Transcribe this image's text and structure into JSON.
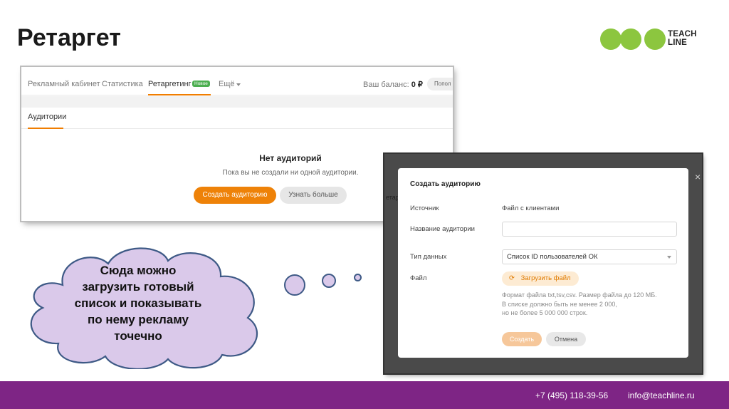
{
  "slide": {
    "title": "Ретаргет"
  },
  "logo": {
    "line1": "TEACH",
    "line2": "LINE",
    "color": "#8cc63f"
  },
  "screenshot1": {
    "nav": {
      "ad_cabinet": "Рекламный кабинет",
      "statistics": "Статистика",
      "retargeting": "Ретаргетинг",
      "new_badge": "Новое",
      "more": "Ещё",
      "balance_label": "Ваш баланс:",
      "balance_value": "0 ₽",
      "topup": "Попол"
    },
    "tab": "Аудитории",
    "empty_title": "Нет аудиторий",
    "empty_subtitle": "Пока вы не создали ни одной аудитории.",
    "create_button": "Создать аудиторию",
    "learn_more_button": "Узнать больше",
    "accent": "#ee8208"
  },
  "screenshot2": {
    "background_label": "етаргети",
    "close": "×",
    "modal": {
      "title": "Создать аудиторию",
      "source_label": "Источник",
      "source_value": "Файл с клиентами",
      "name_label": "Название аудитории",
      "name_value": "",
      "data_type_label": "Тип данных",
      "data_type_value": "Список ID пользователей ОК",
      "file_label": "Файл",
      "upload_button": "Загрузить файл",
      "hint_line1": "Формат файла txt,tsv,csv. Размер файла до 120 МБ.",
      "hint_line2": "В списке должно быть не менее 2 000,",
      "hint_line3": "но не более 5 000 000 строк.",
      "create_button": "Создать",
      "cancel_button": "Отмена"
    }
  },
  "cloud": {
    "line1": "Сюда можно",
    "line2": "загрузить готовый",
    "line3": "список и показывать",
    "line4": "по нему рекламу",
    "line5": "точечно",
    "fill": "#dac9ea",
    "stroke": "#3e5a86"
  },
  "footer": {
    "phone": "+7 (495) 118-39-56",
    "email": "info@teachline.ru",
    "background": "#7e2585"
  }
}
